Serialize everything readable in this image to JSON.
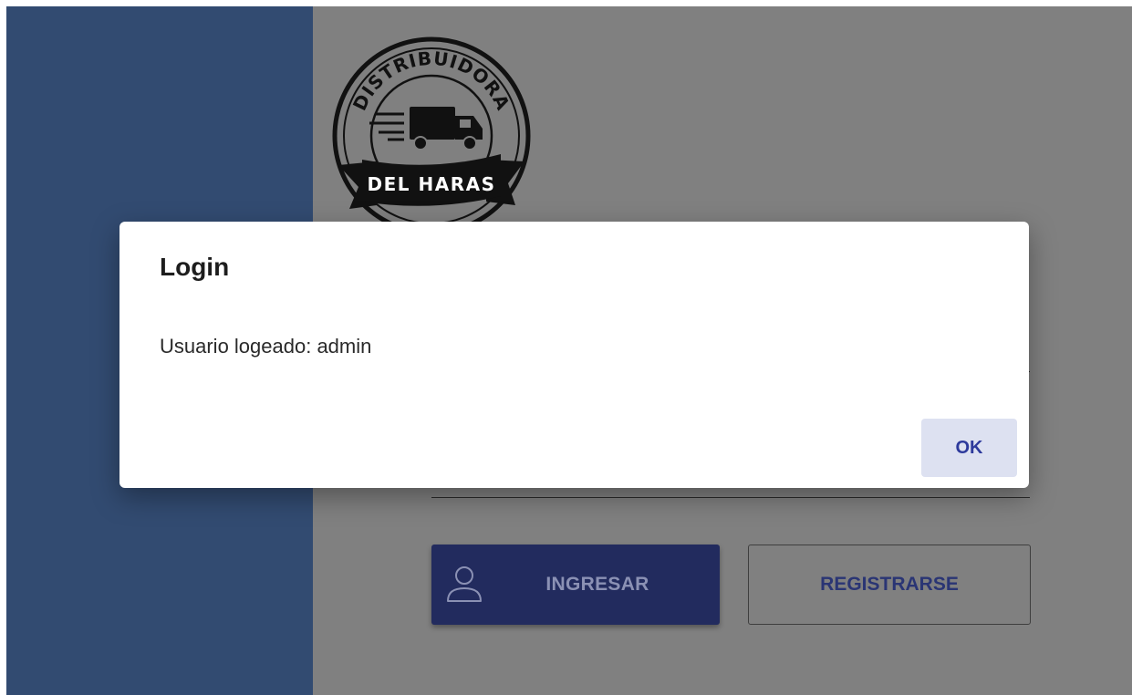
{
  "logo": {
    "top_text": "DISTRIBUIDORA",
    "banner_text": "DEL HARAS"
  },
  "buttons": {
    "ingresar_label": "INGRESAR",
    "registrarse_label": "REGISTRARSE"
  },
  "dialog": {
    "title": "Login",
    "message": "Usuario logeado: admin",
    "ok_label": "OK"
  },
  "colors": {
    "sidebar": "#324b71",
    "overlay_background": "#808080",
    "primary_button": "#222b5e",
    "ok_button_bg": "#dde1f1",
    "ok_button_text": "#2d3a9c"
  },
  "icons": {
    "ingresar_icon": "user-icon",
    "logo_icon": "delivery-truck-icon"
  }
}
